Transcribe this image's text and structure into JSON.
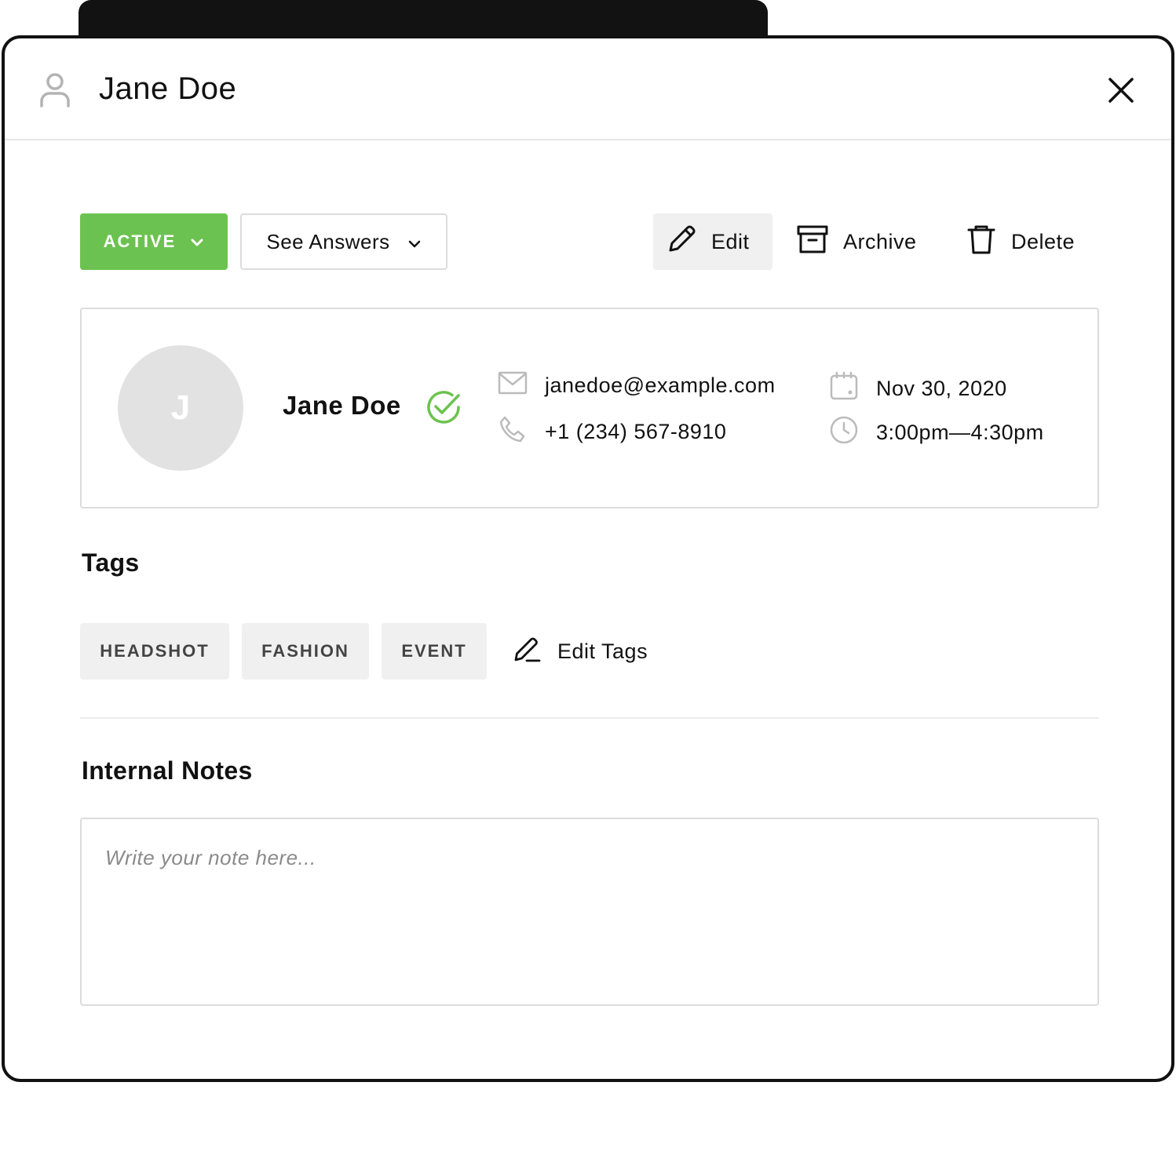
{
  "header": {
    "title": "Jane Doe",
    "icon": "user-icon",
    "close_icon": "close-icon"
  },
  "toolbar": {
    "status_label": "ACTIVE",
    "answers_label": "See Answers",
    "edit_label": "Edit",
    "archive_label": "Archive",
    "delete_label": "Delete"
  },
  "profile": {
    "avatar_initial": "J",
    "name": "Jane Doe",
    "verified": true,
    "email": "janedoe@example.com",
    "phone": "+1 (234) 567-8910",
    "date": "Nov 30, 2020",
    "time": "3:00pm—4:30pm"
  },
  "tags": {
    "title": "Tags",
    "items": [
      "HEADSHOT",
      "FASHION",
      "EVENT"
    ],
    "edit_label": "Edit Tags"
  },
  "notes": {
    "title": "Internal Notes",
    "placeholder": "Write your note here...",
    "value": ""
  },
  "colors": {
    "accent_green": "#6cc250",
    "border": "#dcdcdc",
    "button_bg": "#f0f0f0",
    "avatar_bg": "#e2e2e2",
    "icon_gray": "#bbbbbb"
  }
}
